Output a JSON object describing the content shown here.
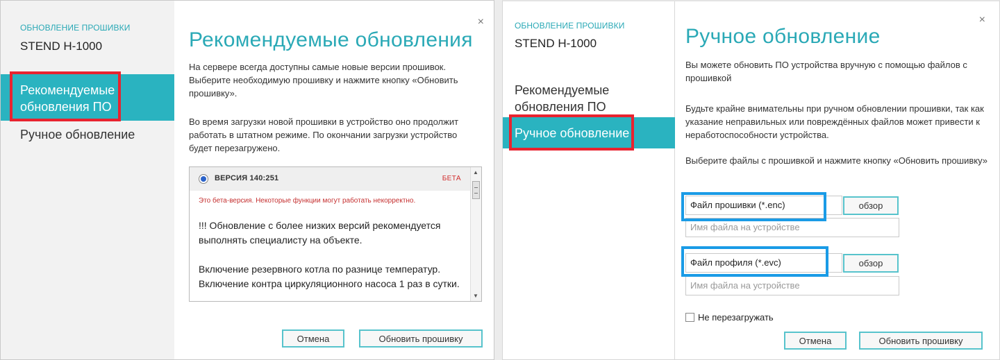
{
  "left_dialog": {
    "sidebar": {
      "caption": "ОБНОВЛЕНИЕ ПРОШИВКИ",
      "device": "STEND H-1000",
      "items": [
        {
          "label": "Рекомендуемые обновления ПО",
          "active": true
        },
        {
          "label": "Ручное обновление",
          "active": false
        }
      ]
    },
    "close_glyph": "×",
    "title": "Рекомендуемые обновления",
    "paragraphs": [
      "На сервере всегда доступны самые новые версии прошивок. Выберите необходимую прошивку и нажмите кнопку «Обновить прошивку».",
      "Во время загрузки новой прошивки в устройство оно продолжит работать в штатном режиме. По окончании загрузки устройство будет перезагружено."
    ],
    "version": {
      "label": "ВЕРСИЯ 140:251",
      "badge": "БЕТА",
      "warning": "Это бета-версия. Некоторые функции могут работать некорректно.",
      "notes": [
        "!!! Обновление с более низких версий рекомендуется выполнять специалисту на объекте.",
        "",
        "Включение резервного котла по разнице температур. Включение контра циркуляционного насоса 1 раз в сутки."
      ]
    },
    "buttons": {
      "cancel": "Отмена",
      "update": "Обновить прошивку"
    }
  },
  "right_dialog": {
    "sidebar": {
      "caption": "ОБНОВЛЕНИЕ ПРОШИВКИ",
      "device": "STEND H-1000",
      "items": [
        {
          "label": "Рекомендуемые обновления ПО",
          "active": false
        },
        {
          "label": "Ручное обновление",
          "active": true
        }
      ]
    },
    "close_glyph": "×",
    "title": "Ручное обновление",
    "paragraphs": [
      "Вы можете обновить ПО устройства вручную с помощью файлов с прошивкой",
      "Будьте крайне внимательны при ручном обновлении прошивки, так как указание неправильных или повреждённых файлов может привести к неработоспособности устройства.",
      "Выберите файлы с прошивкой и нажмите кнопку «Обновить прошивку»"
    ],
    "files": [
      {
        "label": "Файл прошивки (*.enc)",
        "browse": "обзор",
        "placeholder": "Имя файла на устройстве"
      },
      {
        "label": "Файл профиля (*.evc)",
        "browse": "обзор",
        "placeholder": "Имя файла на устройстве"
      }
    ],
    "no_reboot_label": "Не перезагружать",
    "buttons": {
      "cancel": "Отмена",
      "update": "Обновить прошивку"
    }
  },
  "colors": {
    "accent": "#2ab3c0",
    "highlight_red": "#e8232f",
    "highlight_blue": "#1a9be6",
    "beta_red": "#d12c2c"
  }
}
